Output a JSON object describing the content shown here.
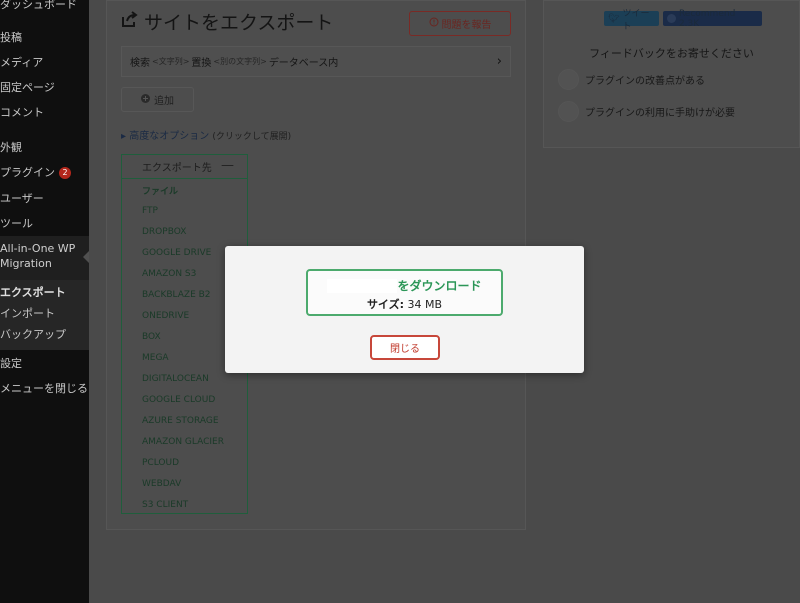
{
  "sidebar": {
    "items": [
      {
        "label": "ダッシュボード"
      },
      {
        "label": "投稿"
      },
      {
        "label": "メディア"
      },
      {
        "label": "固定ページ"
      },
      {
        "label": "コメント"
      },
      {
        "label": "外観"
      },
      {
        "label": "プラグイン",
        "badge": "2"
      },
      {
        "label": "ユーザー"
      },
      {
        "label": "ツール"
      },
      {
        "label": "All-in-One WP"
      },
      {
        "label": "Migration"
      },
      {
        "label": "エクスポート"
      },
      {
        "label": "インポート"
      },
      {
        "label": "バックアップ"
      },
      {
        "label": "設定"
      },
      {
        "label": "メニューを閉じる"
      }
    ]
  },
  "header": {
    "title": "サイトをエクスポート",
    "report_button": "問題を報告"
  },
  "find_replace": {
    "search": "検索",
    "search_hint": "<文字列>",
    "replace": "置換",
    "replace_hint": "<別の文字列>",
    "suffix": "データベース内"
  },
  "add_button": "追加",
  "advanced": {
    "link": "高度なオプション",
    "hint": "(クリックして展開)"
  },
  "export_to": {
    "header": "エクスポート先",
    "items": [
      "ファイル",
      "FTP",
      "DROPBOX",
      "GOOGLE DRIVE",
      "AMAZON S3",
      "BACKBLAZE B2",
      "ONEDRIVE",
      "BOX",
      "MEGA",
      "DIGITALOCEAN",
      "GOOGLE CLOUD",
      "AZURE STORAGE",
      "AMAZON GLACIER",
      "PCLOUD",
      "WEBDAV",
      "S3 CLIENT"
    ]
  },
  "social": {
    "tweet": "ツイート",
    "fb_recommend": "Recommend 2.3K"
  },
  "feedback": {
    "title": "フィードバックをお寄せください",
    "options": [
      "プラグインの改善点がある",
      "プラグインの利用に手助けが必要"
    ]
  },
  "modal": {
    "download_label": "をダウンロード",
    "size_label": "サイズ:",
    "size_value": "34 MB",
    "close_button": "閉じる"
  },
  "colors": {
    "download_green": "#2b9657",
    "close_red": "#c0392b"
  }
}
